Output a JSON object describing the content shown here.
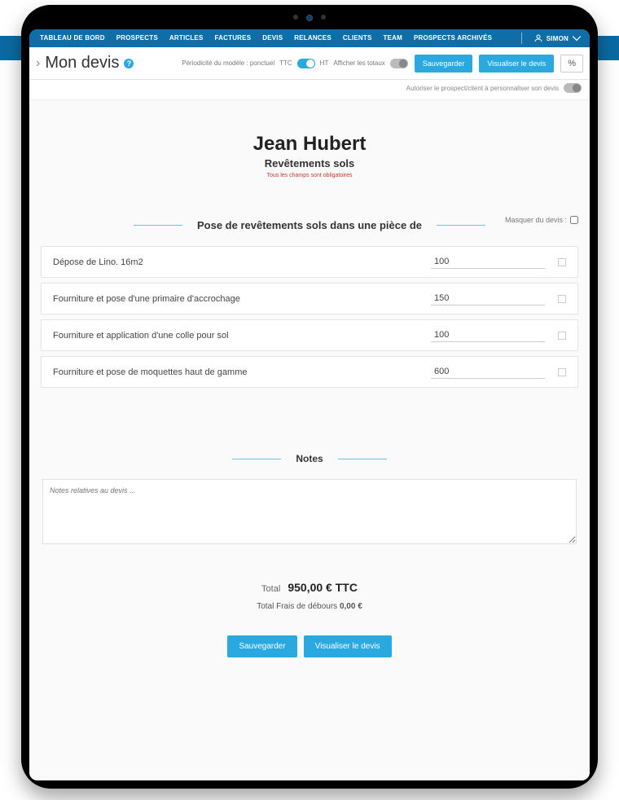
{
  "nav": {
    "items": [
      "TABLEAU DE BORD",
      "PROSPECTS",
      "ARTICLES",
      "FACTURES",
      "DEVIS",
      "RELANCES",
      "CLIENTS",
      "TEAM",
      "PROSPECTS ARCHIVÉS"
    ],
    "user": "SIMON"
  },
  "subbar": {
    "title": "Mon devis",
    "periodicity_label": "Périodicité du modèle : ponctuel",
    "ttc": "TTC",
    "ht": "HT",
    "show_totals": "Afficher les totaux",
    "save": "Sauvegarder",
    "view": "Visualiser le devis",
    "percent": "%"
  },
  "permission": {
    "label": "Autoriser le prospect/client à personnaliser son devis"
  },
  "client": {
    "name": "Jean Hubert",
    "subtitle": "Revêtements sols",
    "required": "Tous les champs sont obligatoires"
  },
  "section": {
    "mask_label": "Masquer du devis :",
    "title": "Pose de revêtements sols dans une pièce de"
  },
  "items": [
    {
      "label": "Dépose de Lino. 16m2",
      "value": "100"
    },
    {
      "label": "Fourniture et pose d'une primaire d'accrochage",
      "value": "150"
    },
    {
      "label": "Fourniture et application d'une colle pour sol",
      "value": "100"
    },
    {
      "label": "Fourniture et pose de moquettes haut de gamme",
      "value": "600"
    }
  ],
  "notes": {
    "title": "Notes",
    "placeholder": "Notes relatives au devis ..."
  },
  "totals": {
    "total_label": "Total",
    "total_value": "950,00 € TTC",
    "fees_label": "Total Frais de débours",
    "fees_value": "0,00 €"
  },
  "bottom": {
    "save": "Sauvegarder",
    "view": "Visualiser le devis"
  }
}
